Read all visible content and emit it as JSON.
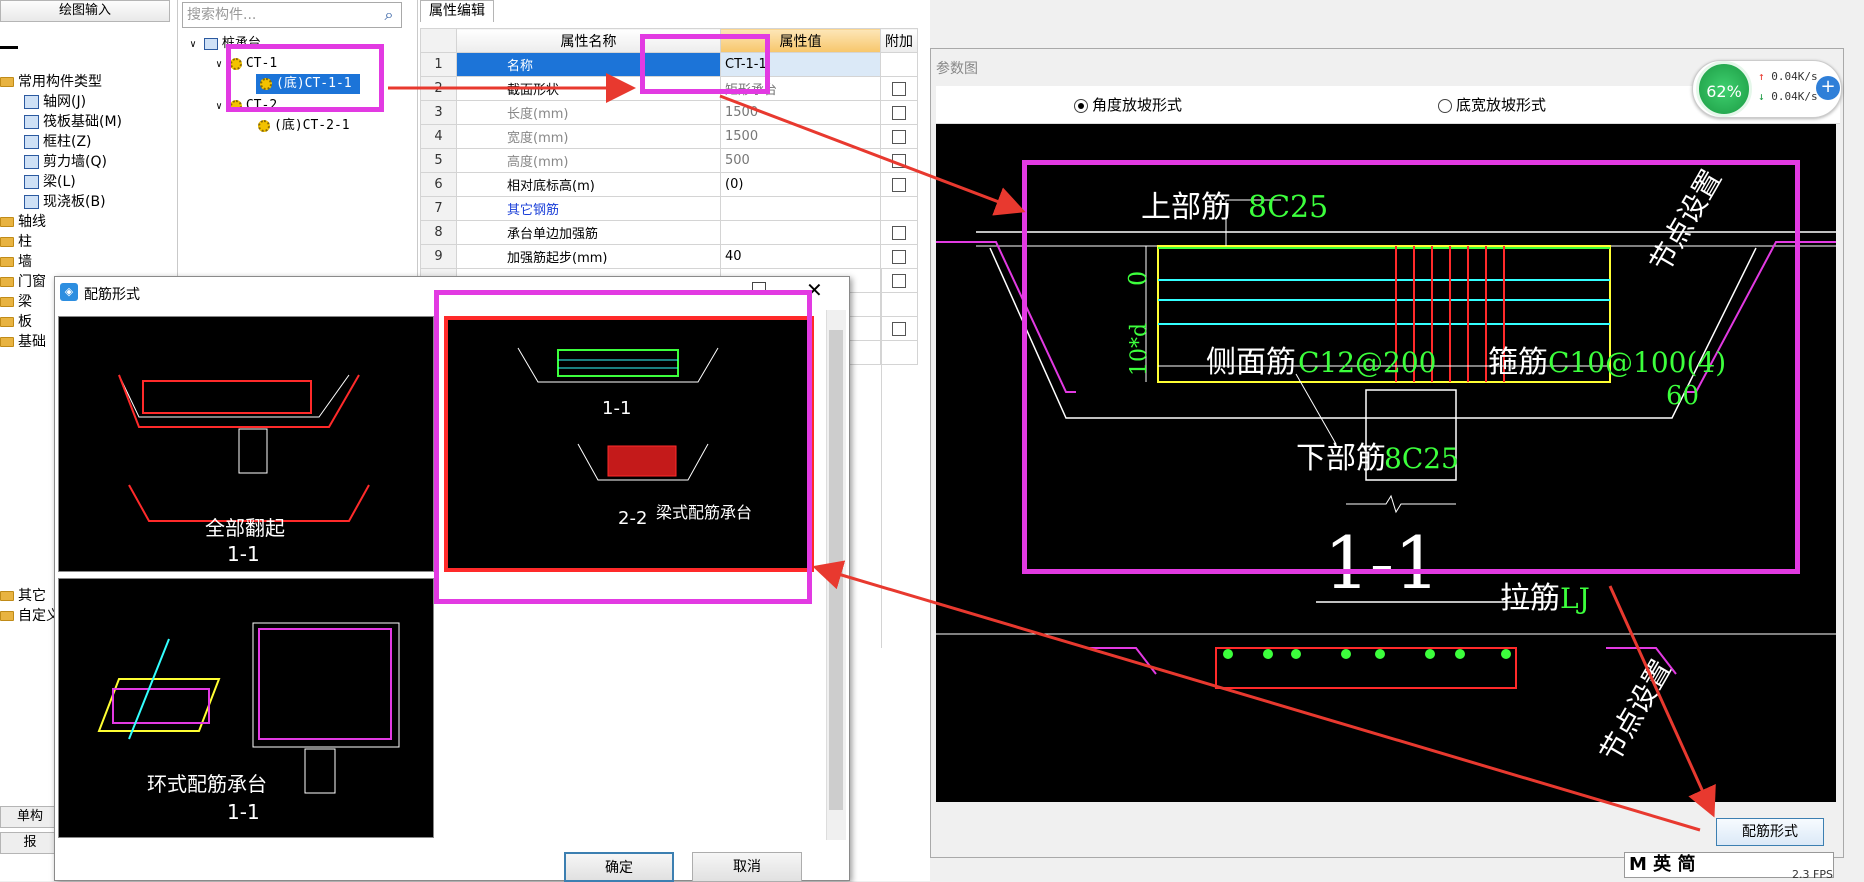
{
  "left_panel": {
    "top_button": "绘图输入",
    "tree": [
      {
        "label": "常用构件类型",
        "kind": "folder"
      },
      {
        "label": "轴网(J)",
        "kind": "item"
      },
      {
        "label": "筏板基础(M)",
        "kind": "item"
      },
      {
        "label": "框柱(Z)",
        "kind": "item"
      },
      {
        "label": "剪力墙(Q)",
        "kind": "item"
      },
      {
        "label": "梁(L)",
        "kind": "item"
      },
      {
        "label": "现浇板(B)",
        "kind": "item"
      },
      {
        "label": "轴线",
        "kind": "folder"
      },
      {
        "label": "柱",
        "kind": "folder"
      },
      {
        "label": "墙",
        "kind": "folder"
      },
      {
        "label": "门窗",
        "kind": "folder"
      },
      {
        "label": "梁",
        "kind": "folder"
      },
      {
        "label": "板",
        "kind": "folder"
      },
      {
        "label": "基础",
        "kind": "folder"
      }
    ],
    "bottom_items": [
      "其它",
      "自定义"
    ],
    "bottom_buttons": [
      "单构",
      "报"
    ]
  },
  "component_tree": {
    "search_placeholder": "搜索构件...",
    "root": "桩承台",
    "nodes": [
      "CT-1",
      "(底)CT-1-1",
      "CT-2",
      "(底)CT-2-1"
    ]
  },
  "property_editor": {
    "tab": "属性编辑",
    "headers": [
      "属性名称",
      "属性值",
      "附加"
    ],
    "rows": [
      {
        "num": "1",
        "name": "名称",
        "value": "CT-1-1",
        "check": false
      },
      {
        "num": "2",
        "name": "截面形状",
        "value": "矩形承台",
        "check": true
      },
      {
        "num": "3",
        "name": "长度(mm)",
        "value": "1500",
        "check": true
      },
      {
        "num": "4",
        "name": "宽度(mm)",
        "value": "1500",
        "check": true
      },
      {
        "num": "5",
        "name": "高度(mm)",
        "value": "500",
        "check": true
      },
      {
        "num": "6",
        "name": "相对底标高(m)",
        "value": "(0)",
        "check": true
      },
      {
        "num": "7",
        "name": "其它钢筋",
        "value": "",
        "check": false
      },
      {
        "num": "8",
        "name": "承台单边加强筋",
        "value": "",
        "check": true
      },
      {
        "num": "9",
        "name": "加强筋起步(mm)",
        "value": "40",
        "check": true
      }
    ]
  },
  "param_figure": {
    "title": "参数图",
    "radio_angle": "角度放坡形式",
    "radio_width": "底宽放坡形式",
    "cad": {
      "top_bar": "上部筋",
      "top_bar_val": "8C25",
      "side_bar": "侧面筋",
      "side_bar_val": "C12@200",
      "stirrup": "箍筋",
      "stirrup_val": "C10@100(4)",
      "bottom_bar": "下部筋",
      "bottom_bar_val": "8C25",
      "section": "1-1",
      "tie_bar": "拉筋",
      "tie_bar_val": "LJ",
      "node_setting": "节点设置",
      "angle": "60",
      "zero": "0",
      "ten_d": "10*d"
    },
    "button": "配筋形式"
  },
  "net_widget": {
    "percent": "62%",
    "up": "0.04K/s",
    "down": "0.04K/s"
  },
  "dialog": {
    "title": "配筋形式",
    "thumbs": [
      {
        "caption": "全部翻起",
        "section": "1-1"
      },
      {
        "caption": "梁式配筋承台",
        "section": "2-2",
        "section_top": "1-1"
      },
      {
        "caption": "环式配筋承台",
        "section": "1-1"
      }
    ],
    "ok": "确定",
    "cancel": "取消"
  },
  "ime": {
    "text": "M 英 简"
  },
  "fps": "2.3 FPS",
  "colors": {
    "highlight": "#e23ae2",
    "arrow": "#e8392f",
    "select": "#1c74d8",
    "cad_green": "#3cff3c"
  }
}
